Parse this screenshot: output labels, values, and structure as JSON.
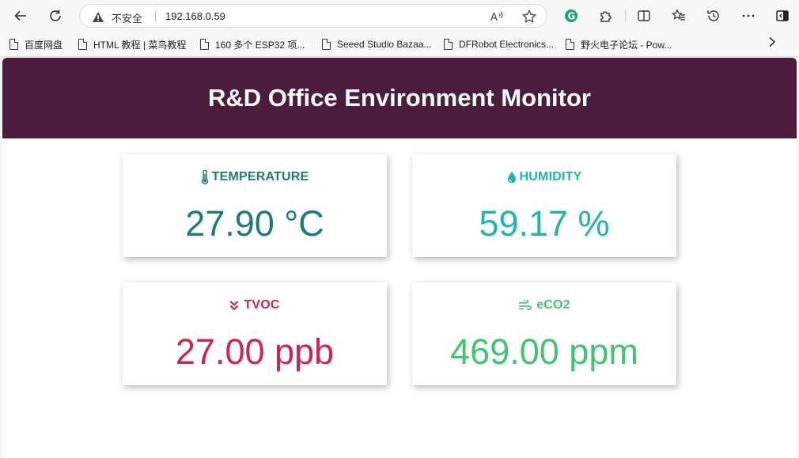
{
  "browser": {
    "insecure_label": "不安全",
    "url": "192.168.0.59"
  },
  "bookmarks": [
    {
      "label": "百度网盘"
    },
    {
      "label": "HTML 教程 | 菜鸟教程"
    },
    {
      "label": "160 多个 ESP32 项..."
    },
    {
      "label": "Seeed Studio Bazaa..."
    },
    {
      "label": "DFRobot Electronics..."
    },
    {
      "label": "野火电子论坛 - Pow..."
    }
  ],
  "page": {
    "title": "R&D Office Environment Monitor",
    "header_color": "#4b1c3e"
  },
  "cards": {
    "temperature": {
      "label": "TEMPERATURE",
      "value": "27.90 °C",
      "color": "#1b7b7b",
      "icon": "thermometer-icon"
    },
    "humidity": {
      "label": "HUMIDITY",
      "value": "59.17 %",
      "color": "#1fb3b3",
      "icon": "droplet-icon"
    },
    "tvoc": {
      "label": "TVOC",
      "value": "27.00 ppb",
      "color": "#d02450",
      "icon": "double-chevron-down-icon"
    },
    "eco2": {
      "label": "eCO2",
      "value": "469.00 ppm",
      "color": "#40c470",
      "icon": "wind-icon"
    }
  }
}
